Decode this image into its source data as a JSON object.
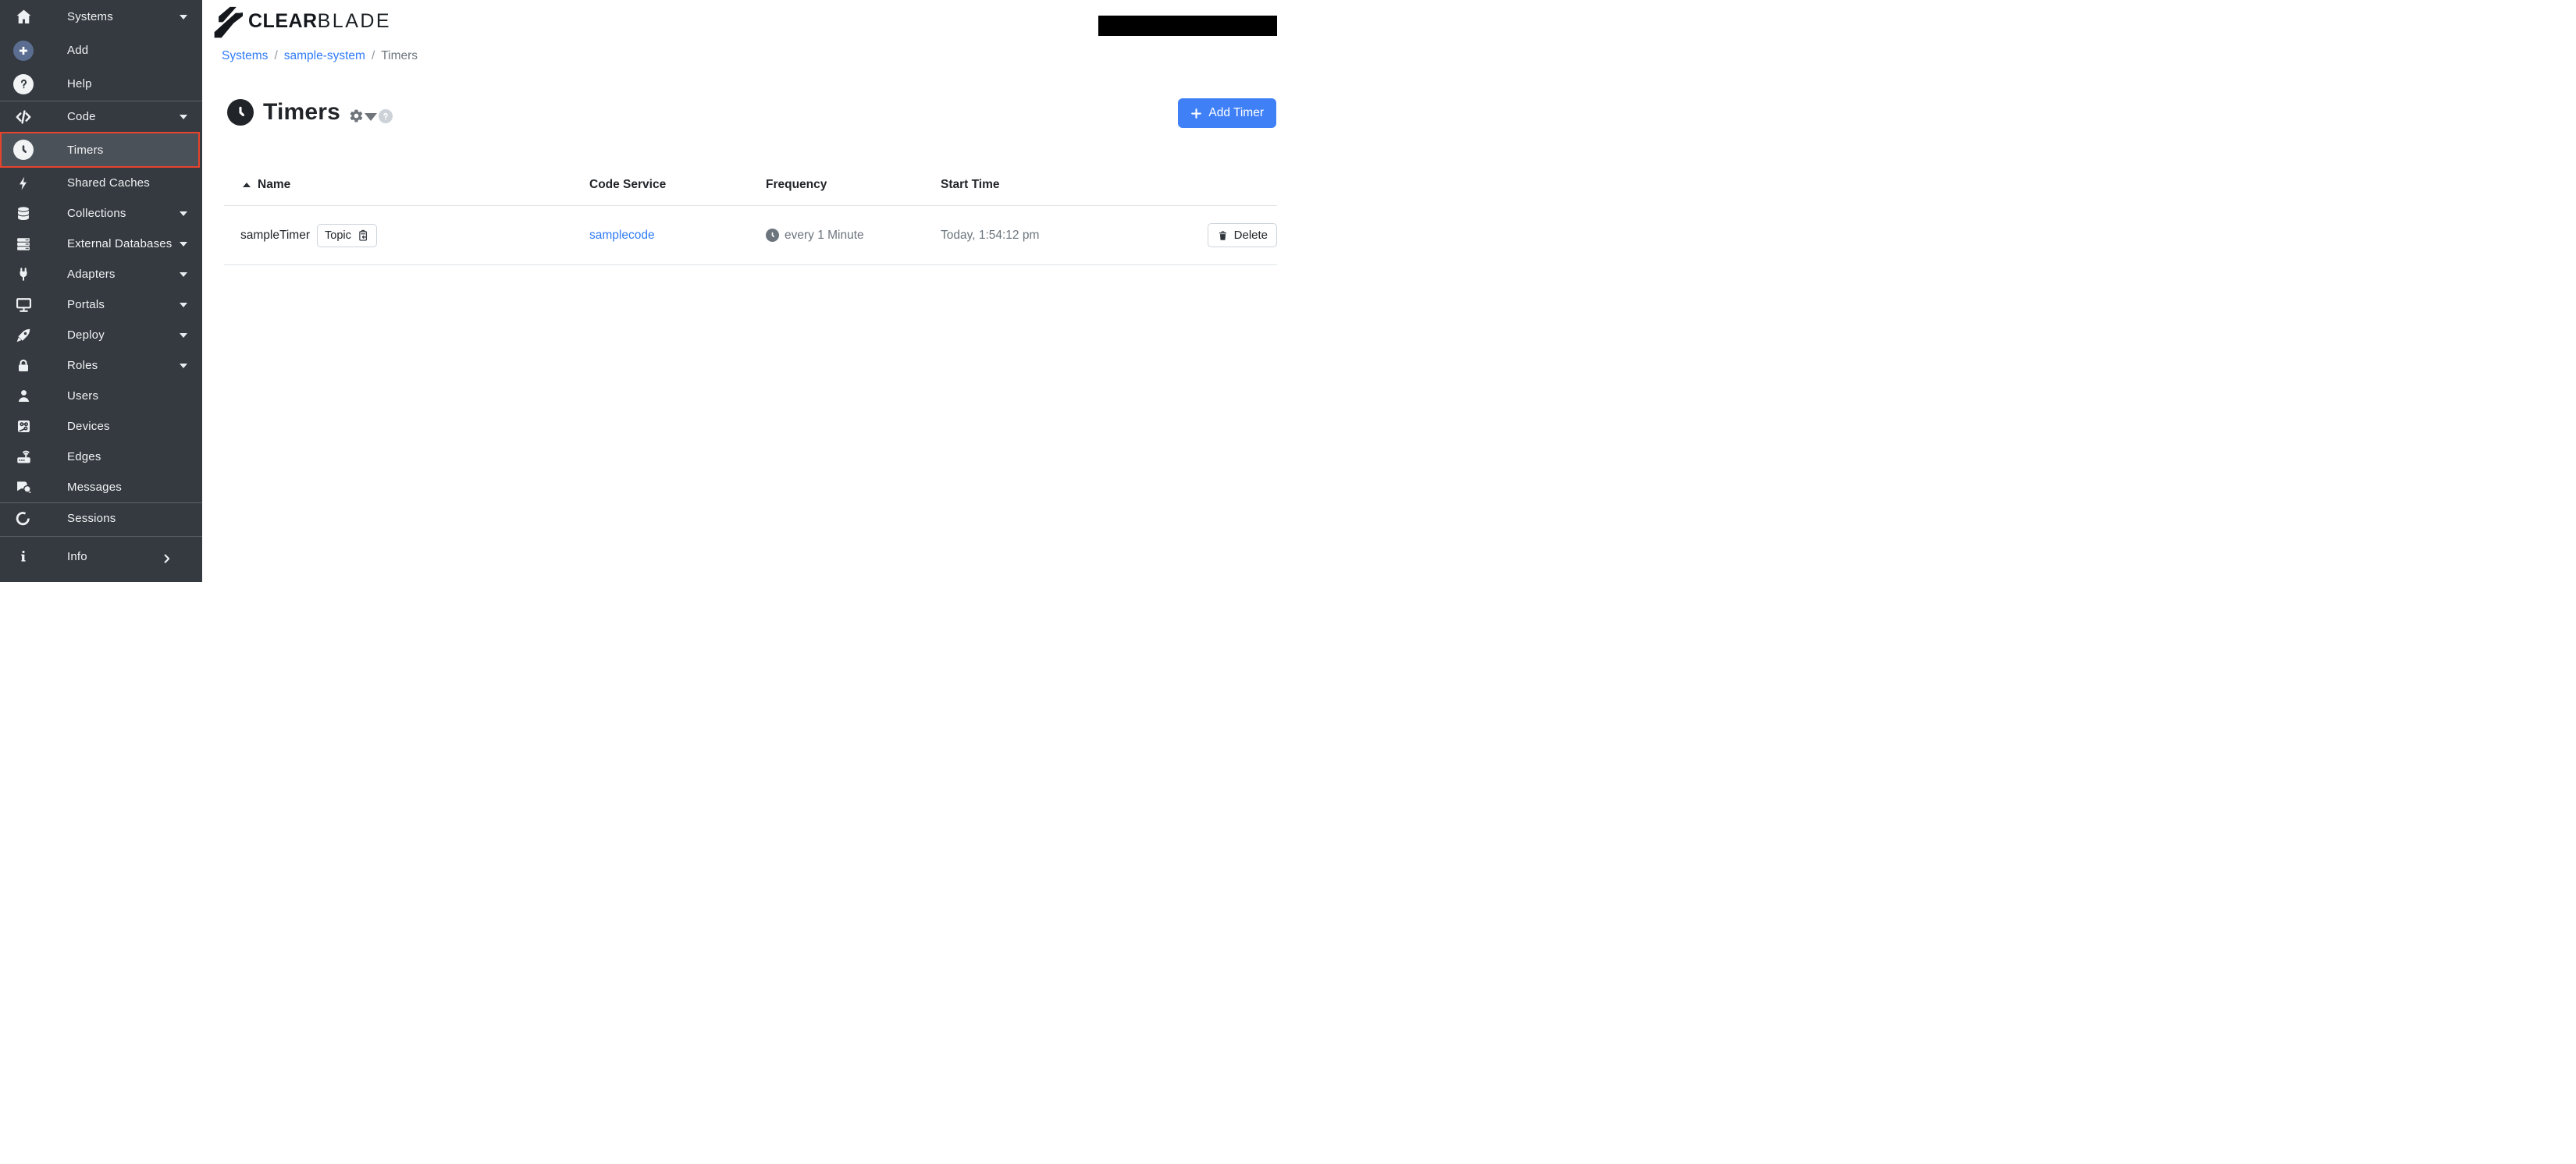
{
  "brand": {
    "name_bold": "CLEAR",
    "name_light": "BLADE"
  },
  "breadcrumb": {
    "separator": "/",
    "items": [
      {
        "label": "Systems"
      },
      {
        "label": "sample-system"
      },
      {
        "label": "Timers"
      }
    ]
  },
  "sidebar": {
    "items": [
      {
        "label": "Systems"
      },
      {
        "label": "Add"
      },
      {
        "label": "Help"
      },
      {
        "label": "Code"
      },
      {
        "label": "Timers"
      },
      {
        "label": "Shared Caches"
      },
      {
        "label": "Collections"
      },
      {
        "label": "External Databases"
      },
      {
        "label": "Adapters"
      },
      {
        "label": "Portals"
      },
      {
        "label": "Deploy"
      },
      {
        "label": "Roles"
      },
      {
        "label": "Users"
      },
      {
        "label": "Devices"
      },
      {
        "label": "Edges"
      },
      {
        "label": "Messages"
      },
      {
        "label": "Sessions"
      },
      {
        "label": "Info"
      }
    ],
    "selected_item": "Timers"
  },
  "page": {
    "title": "Timers",
    "add_button_label": "Add Timer"
  },
  "table": {
    "columns": [
      "Name",
      "Code Service",
      "Frequency",
      "Start Time"
    ],
    "sort": {
      "column": "Name",
      "direction": "ascending"
    },
    "row": {
      "name": "sampleTimer",
      "topic_button": "Topic",
      "code_service": "samplecode",
      "frequency": "every 1 Minute",
      "start_time": "Today, 1:54:12 pm",
      "delete_button": "Delete"
    }
  },
  "colors": {
    "sidebar_bg": "#343a40",
    "sidebar_selected_bg": "#4b5158",
    "selected_border_red": "#e8432d",
    "link_blue": "#2f7bf6",
    "button_blue": "#3f80f7",
    "muted_gray": "#6c757d",
    "table_border": "#dee2e6"
  }
}
